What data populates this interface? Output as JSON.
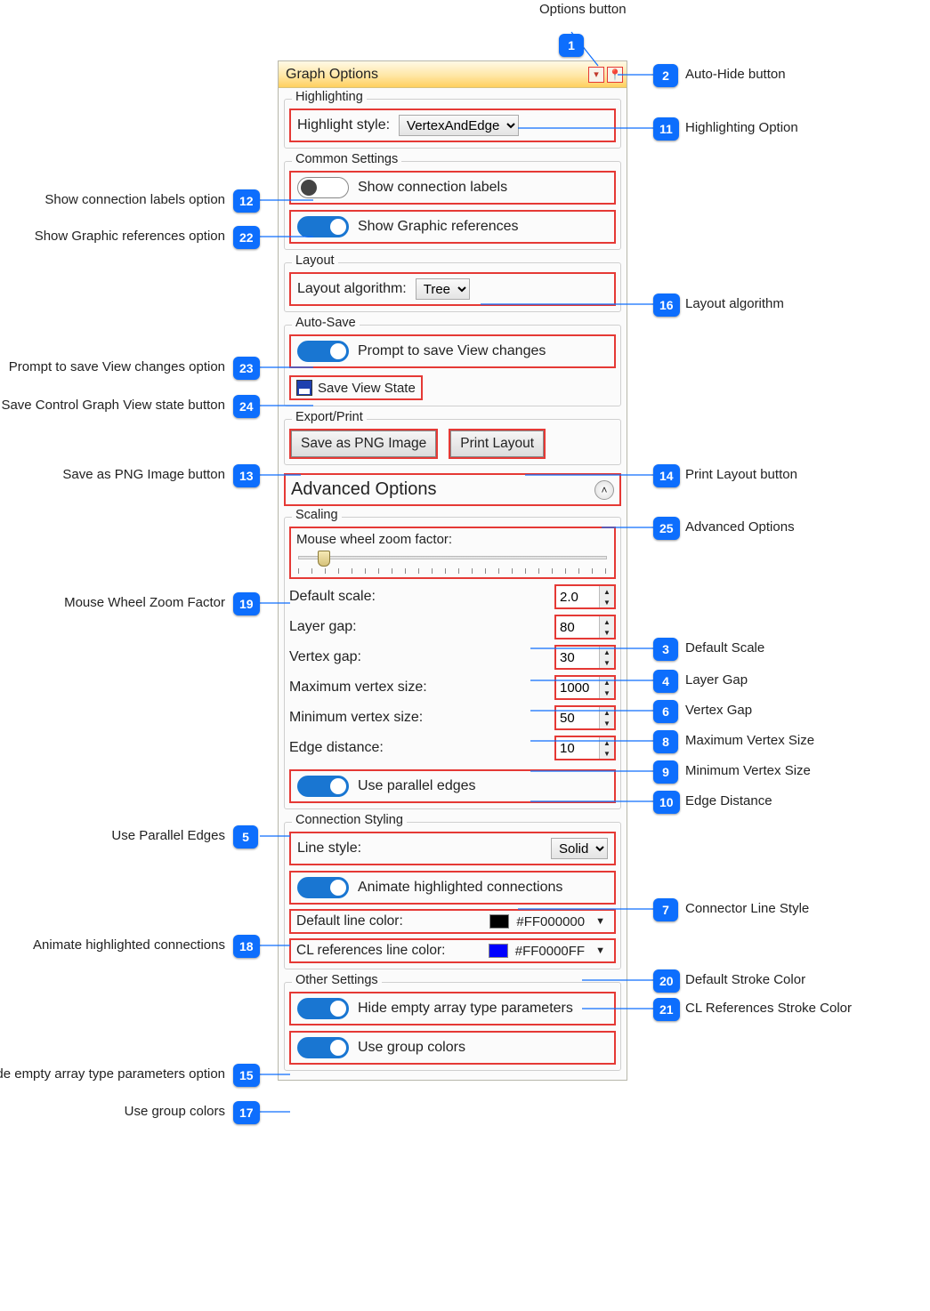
{
  "header": {
    "title": "Graph Options"
  },
  "groups": {
    "highlighting": {
      "title": "Highlighting",
      "label": "Highlight style:",
      "value": "VertexAndEdge"
    },
    "common": {
      "title": "Common Settings",
      "showLabels": "Show connection labels",
      "showGraphic": "Show Graphic references"
    },
    "layout": {
      "title": "Layout",
      "label": "Layout algorithm:",
      "value": "Tree"
    },
    "autosave": {
      "title": "Auto-Save",
      "prompt": "Prompt to save View changes",
      "saveState": "Save View State"
    },
    "export": {
      "title": "Export/Print",
      "png": "Save as PNG Image",
      "print": "Print Layout"
    },
    "advanced": "Advanced Options",
    "scaling": {
      "title": "Scaling",
      "mouseWheel": "Mouse wheel zoom factor:",
      "rows": {
        "defaultScale": {
          "label": "Default scale:",
          "value": "2.0"
        },
        "layerGap": {
          "label": "Layer gap:",
          "value": "80"
        },
        "vertexGap": {
          "label": "Vertex gap:",
          "value": "30"
        },
        "maxVertex": {
          "label": "Maximum vertex size:",
          "value": "1000"
        },
        "minVertex": {
          "label": "Minimum vertex size:",
          "value": "50"
        },
        "edgeDist": {
          "label": "Edge distance:",
          "value": "10"
        }
      },
      "parallel": "Use parallel edges"
    },
    "connStyle": {
      "title": "Connection Styling",
      "lineStyleLabel": "Line style:",
      "lineStyleValue": "Solid",
      "animate": "Animate highlighted connections",
      "defaultColorLabel": "Default line color:",
      "defaultColorValue": "#FF000000",
      "clColorLabel": "CL references line color:",
      "clColorValue": "#FF0000FF"
    },
    "other": {
      "title": "Other Settings",
      "hideEmpty": "Hide empty array type parameters",
      "groupColors": "Use group colors"
    }
  },
  "callouts": {
    "top": "Options button",
    "c1": "1",
    "c2": {
      "n": "2",
      "t": "Auto-Hide button"
    },
    "c3": {
      "n": "3",
      "t": "Default Scale"
    },
    "c4": {
      "n": "4",
      "t": "Layer Gap"
    },
    "c5": {
      "n": "5",
      "t": "Use Parallel Edges"
    },
    "c6": {
      "n": "6",
      "t": "Vertex Gap"
    },
    "c7": {
      "n": "7",
      "t": "Connector Line Style"
    },
    "c8": {
      "n": "8",
      "t": "Maximum Vertex Size"
    },
    "c9": {
      "n": "9",
      "t": "Minimum Vertex Size"
    },
    "c10": {
      "n": "10",
      "t": "Edge Distance"
    },
    "c11": {
      "n": "11",
      "t": "Highlighting Option"
    },
    "c12": {
      "n": "12",
      "t": "Show connection labels option"
    },
    "c13": {
      "n": "13",
      "t": "Save as PNG Image button"
    },
    "c14": {
      "n": "14",
      "t": "Print Layout button"
    },
    "c15": {
      "n": "15",
      "t": "Hide empty array type parameters option"
    },
    "c16": {
      "n": "16",
      "t": "Layout algorithm"
    },
    "c17": {
      "n": "17",
      "t": "Use group colors"
    },
    "c18": {
      "n": "18",
      "t": "Animate highlighted connections"
    },
    "c19": {
      "n": "19",
      "t": "Mouse Wheel Zoom Factor"
    },
    "c20": {
      "n": "20",
      "t": "Default Stroke Color"
    },
    "c21": {
      "n": "21",
      "t": "CL References Stroke Color"
    },
    "c22": {
      "n": "22",
      "t": "Show Graphic references option"
    },
    "c23": {
      "n": "23",
      "t": "Prompt to save View changes option"
    },
    "c24": {
      "n": "24",
      "t": "Save Control Graph View state button"
    },
    "c25": {
      "n": "25",
      "t": "Advanced Options"
    }
  }
}
